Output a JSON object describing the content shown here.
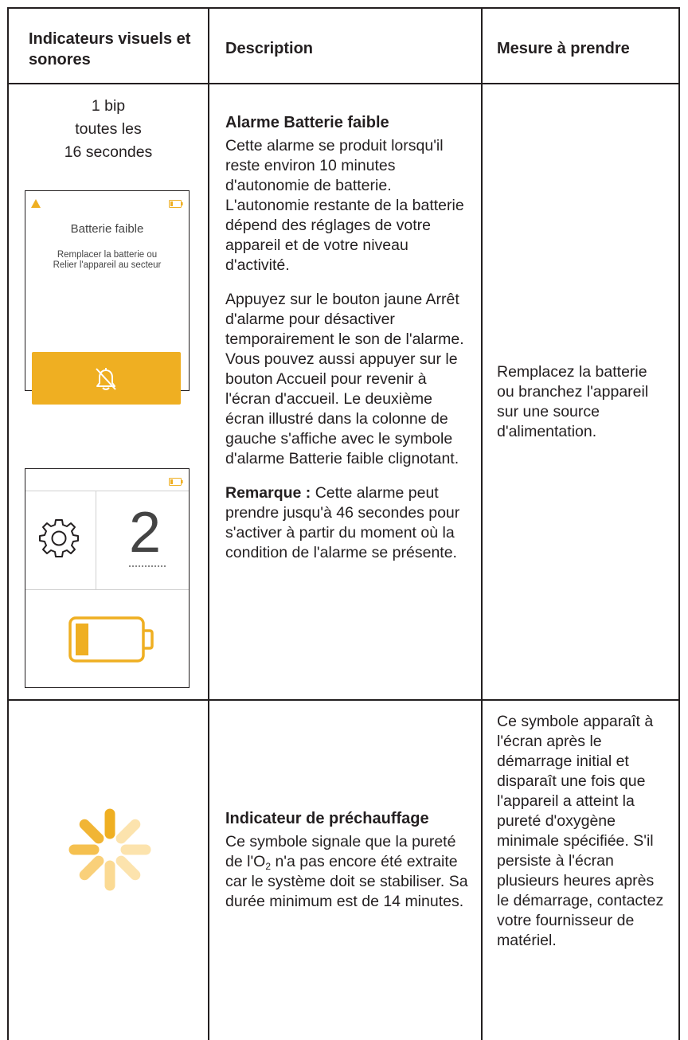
{
  "table": {
    "headers": {
      "visual": "Indicateurs visuels et sonores",
      "description": "Description",
      "action": "Mesure à prendre"
    },
    "rows": [
      {
        "visual": {
          "beep_line1": "1 bip",
          "beep_line2": "toutes les",
          "beep_line3": "16 secondes",
          "screen1": {
            "alarm_icon": "warning-triangle-icon",
            "battery_icon": "battery-low-icon",
            "title": "Batterie faible",
            "message_line1": "Remplacer la batterie ou",
            "message_line2": "Relier l'appareil au secteur",
            "button_icon": "alarm-silence-icon",
            "button_color": "#EFAF22"
          },
          "screen2": {
            "battery_icon": "battery-low-icon",
            "settings_icon": "gear-icon",
            "flow_value": "2",
            "large_battery_icon": "battery-flashing-icon",
            "accent_color": "#EFAF22"
          }
        },
        "description": {
          "title": "Alarme Batterie faible",
          "para1": "Cette alarme se produit lorsqu'il reste environ 10 minutes d'autonomie de batterie. L'autonomie restante de la batterie dépend des réglages de votre appareil et de votre niveau d'activité.",
          "para2": "Appuyez sur le bouton jaune Arrêt d'alarme pour désactiver temporairement le son de l'alarme. Vous pouvez aussi appuyer sur le bouton Accueil pour revenir à l'écran d'accueil. Le deuxième écran illustré dans la colonne de gauche s'affiche avec le symbole d'alarme Batterie faible clignotant.",
          "note_label": "Remarque :",
          "note_text": "Cette alarme peut prendre jusqu'à 46 secondes pour s'activer à partir du moment où la condition de l'alarme se présente."
        },
        "action": "Remplacez la batterie ou branchez l'appareil sur une source d'alimentation."
      },
      {
        "visual": {
          "icon": "warm-up-spinner-icon"
        },
        "description": {
          "title": "Indicateur de préchauffage",
          "text_before": "Ce symbole signale que la pureté de l'O",
          "subscript": "2",
          "text_after": " n'a pas encore été extraite car le système doit se stabiliser. Sa durée minimum est de 14 minutes."
        },
        "action": "Ce symbole apparaît à l'écran après le démarrage initial et disparaît une fois que l'appareil a atteint la pureté d'oxygène minimale spécifiée. S'il persiste à l'écran plusieurs heures après le démarrage, contactez votre fournisseur de matériel."
      }
    ]
  }
}
